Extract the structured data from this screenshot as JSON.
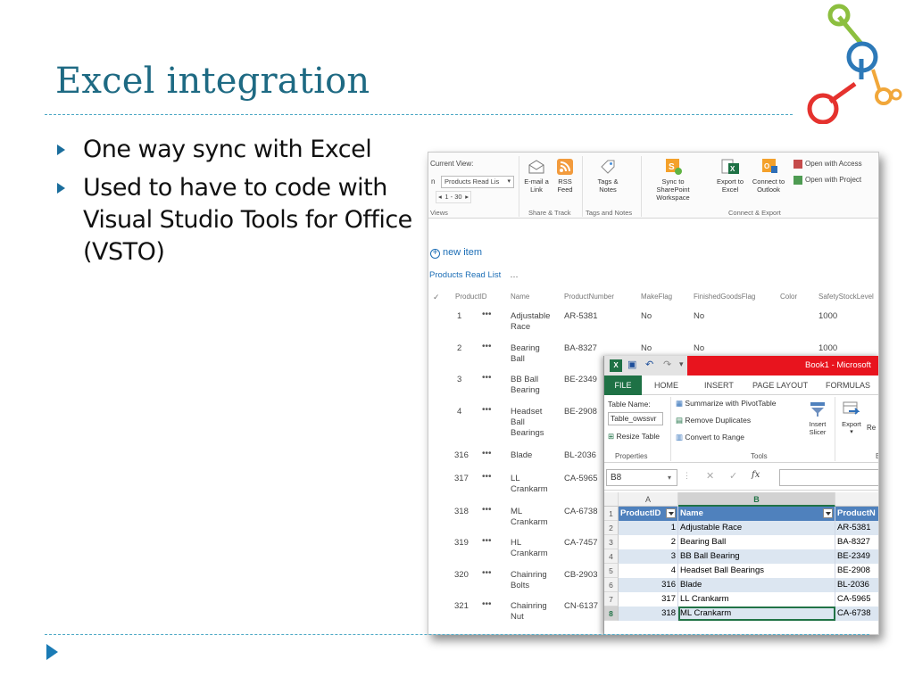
{
  "slide": {
    "title": "Excel integration",
    "bullets": [
      "One way sync with Excel",
      "Used to have to code with Visual Studio Tools for Office (VSTO)"
    ],
    "logo": "network-nodes-logo"
  },
  "sharepoint": {
    "ribbon": {
      "current_view_label": "Current View:",
      "current_view_value": "Products Read Lis",
      "pager": "1 - 30",
      "views_group": "Views",
      "email_link": "E-mail a\nLink",
      "rss_feed": "RSS\nFeed",
      "share_track_group": "Share & Track",
      "tags_notes": "Tags &\nNotes",
      "tags_group": "Tags and Notes",
      "sync_sharepoint": "Sync to SharePoint\nWorkspace",
      "export_excel": "Export to\nExcel",
      "connect_outlook": "Connect to\nOutlook",
      "open_access": "Open with Access",
      "open_project": "Open with Project",
      "connect_export_group": "Connect & Export",
      "left_cut_char": "n"
    },
    "new_item": "new item",
    "view_name": "Products Read List",
    "more_menu": "…",
    "columns": [
      "ProductID",
      "Name",
      "ProductNumber",
      "MakeFlag",
      "FinishedGoodsFlag",
      "Color",
      "SafetyStockLevel"
    ],
    "rows": [
      {
        "id": "1",
        "name": "Adjustable\nRace",
        "number": "AR-5381",
        "make": "No",
        "finished": "No",
        "safety": "1000"
      },
      {
        "id": "2",
        "name": "Bearing\nBall",
        "number": "BA-8327",
        "make": "No",
        "finished": "No",
        "safety": "1000"
      },
      {
        "id": "3",
        "name": "BB Ball\nBearing",
        "number": "BE-2349",
        "make": "",
        "finished": "",
        "safety": ""
      },
      {
        "id": "4",
        "name": "Headset\nBall\nBearings",
        "number": "BE-2908",
        "make": "",
        "finished": "",
        "safety": ""
      },
      {
        "id": "316",
        "name": "Blade",
        "number": "BL-2036",
        "make": "",
        "finished": "",
        "safety": ""
      },
      {
        "id": "317",
        "name": "LL\nCrankarm",
        "number": "CA-5965",
        "make": "",
        "finished": "",
        "safety": ""
      },
      {
        "id": "318",
        "name": "ML\nCrankarm",
        "number": "CA-6738",
        "make": "",
        "finished": "",
        "safety": ""
      },
      {
        "id": "319",
        "name": "HL\nCrankarm",
        "number": "CA-7457",
        "make": "",
        "finished": "",
        "safety": ""
      },
      {
        "id": "320",
        "name": "Chainring\nBolts",
        "number": "CB-2903",
        "make": "",
        "finished": "",
        "safety": ""
      },
      {
        "id": "321",
        "name": "Chainring\nNut",
        "number": "CN-6137",
        "make": "",
        "finished": "",
        "safety": ""
      }
    ]
  },
  "excel": {
    "book_title": "Book1 - Microsoft",
    "tabs": [
      "FILE",
      "HOME",
      "INSERT",
      "PAGE LAYOUT",
      "FORMULAS"
    ],
    "table_name_label": "Table Name:",
    "table_name_value": "Table_owssvr",
    "resize_table": "Resize Table",
    "properties_group": "Properties",
    "summarize_pivot": "Summarize with PivotTable",
    "remove_duplicates": "Remove Duplicates",
    "convert_range": "Convert to Range",
    "tools_group": "Tools",
    "insert_slicer": "Insert\nSlicer",
    "export": "Export",
    "refresh_cut": "Re",
    "group_cut": "E",
    "name_box": "B8",
    "fx": "fx",
    "col_headers": [
      "A",
      "B"
    ],
    "table_headers": [
      "ProductID",
      "Name",
      "ProductN"
    ],
    "rows": [
      {
        "n": "1",
        "id": "",
        "name": "",
        "num": ""
      },
      {
        "n": "2",
        "id": "1",
        "name": "Adjustable Race",
        "num": "AR-5381"
      },
      {
        "n": "3",
        "id": "2",
        "name": "Bearing Ball",
        "num": "BA-8327"
      },
      {
        "n": "4",
        "id": "3",
        "name": "BB Ball Bearing",
        "num": "BE-2349"
      },
      {
        "n": "5",
        "id": "4",
        "name": "Headset Ball Bearings",
        "num": "BE-2908"
      },
      {
        "n": "6",
        "id": "316",
        "name": "Blade",
        "num": "BL-2036"
      },
      {
        "n": "7",
        "id": "317",
        "name": "LL Crankarm",
        "num": "CA-5965"
      },
      {
        "n": "8",
        "id": "318",
        "name": "ML Crankarm",
        "num": "CA-6738"
      }
    ]
  },
  "colors": {
    "title": "#1e6a83",
    "rule": "#4aa7c4",
    "excel_red": "#e8141e",
    "excel_green": "#1e7145",
    "table_header": "#4f81bd",
    "table_band": "#dce6f1",
    "sp_link": "#1c6eb6"
  }
}
